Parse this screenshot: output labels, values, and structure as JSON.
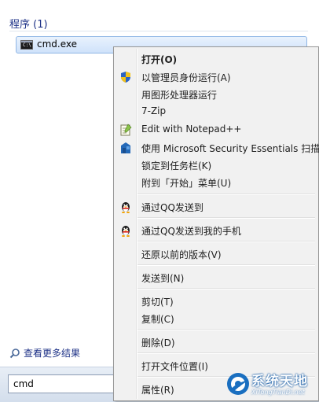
{
  "start_menu": {
    "section_header": "程序 (1)",
    "result": {
      "label": "cmd.exe",
      "icon": "cmd-icon"
    },
    "see_more": "查看更多结果",
    "search_value": "cmd"
  },
  "context_menu": {
    "items": [
      {
        "label": "打开(O)",
        "bold": true,
        "icon": ""
      },
      {
        "label": "以管理员身份运行(A)",
        "icon": "uac-shield-icon"
      },
      {
        "label": "用图形处理器运行",
        "icon": ""
      },
      {
        "label": "7-Zip",
        "icon": ""
      },
      {
        "label": "Edit with Notepad++",
        "icon": "notepad-plus-plus-icon"
      },
      {
        "label": "使用 Microsoft Security Essentials 扫描...",
        "icon": "security-essentials-icon"
      },
      {
        "label": "锁定到任务栏(K)",
        "icon": ""
      },
      {
        "label": "附到「开始」菜单(U)",
        "icon": ""
      },
      {
        "label": "通过QQ发送到",
        "icon": "qq-penguin-icon"
      },
      {
        "label": "通过QQ发送到我的手机",
        "icon": "qq-penguin-icon"
      },
      {
        "label": "还原以前的版本(V)",
        "icon": ""
      },
      {
        "label": "发送到(N)",
        "icon": ""
      },
      {
        "label": "剪切(T)",
        "icon": ""
      },
      {
        "label": "复制(C)",
        "icon": ""
      },
      {
        "label": "删除(D)",
        "icon": ""
      },
      {
        "label": "打开文件位置(I)",
        "icon": ""
      },
      {
        "label": "属性(R)",
        "icon": ""
      }
    ]
  },
  "watermark": {
    "name": "系统天地",
    "url": "XiTongTianDi.net"
  }
}
